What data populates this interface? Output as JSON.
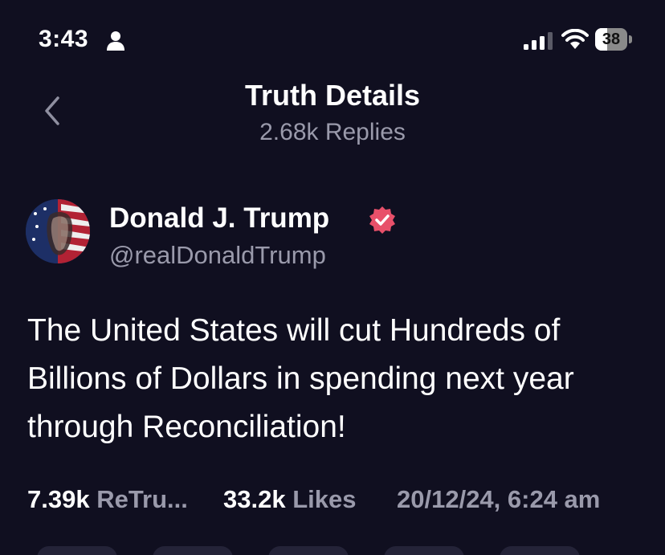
{
  "status_bar": {
    "time": "3:43",
    "battery_level": "38",
    "battery_fraction": 0.38,
    "icons": [
      "person-icon",
      "cellular-signal-icon",
      "wifi-icon",
      "battery-icon"
    ]
  },
  "header": {
    "title": "Truth Details",
    "subtitle": "2.68k Replies",
    "back_icon": "chevron-left-icon"
  },
  "post": {
    "author_name": "Donald J. Trump",
    "author_handle": "@realDonaldTrump",
    "verified_color": "#e8506a",
    "text": "The United States will cut Hundreds of Billions of Dollars in spending next year through Reconciliation!",
    "stats": {
      "retruths_count": "7.39k",
      "retruths_label": "ReTru...",
      "likes_count": "33.2k",
      "likes_label": "Likes",
      "timestamp": "20/12/24, 6:24 am"
    }
  },
  "colors": {
    "background": "#100f20",
    "secondary_text": "#9a9aab",
    "primary_text": "#ffffff"
  }
}
